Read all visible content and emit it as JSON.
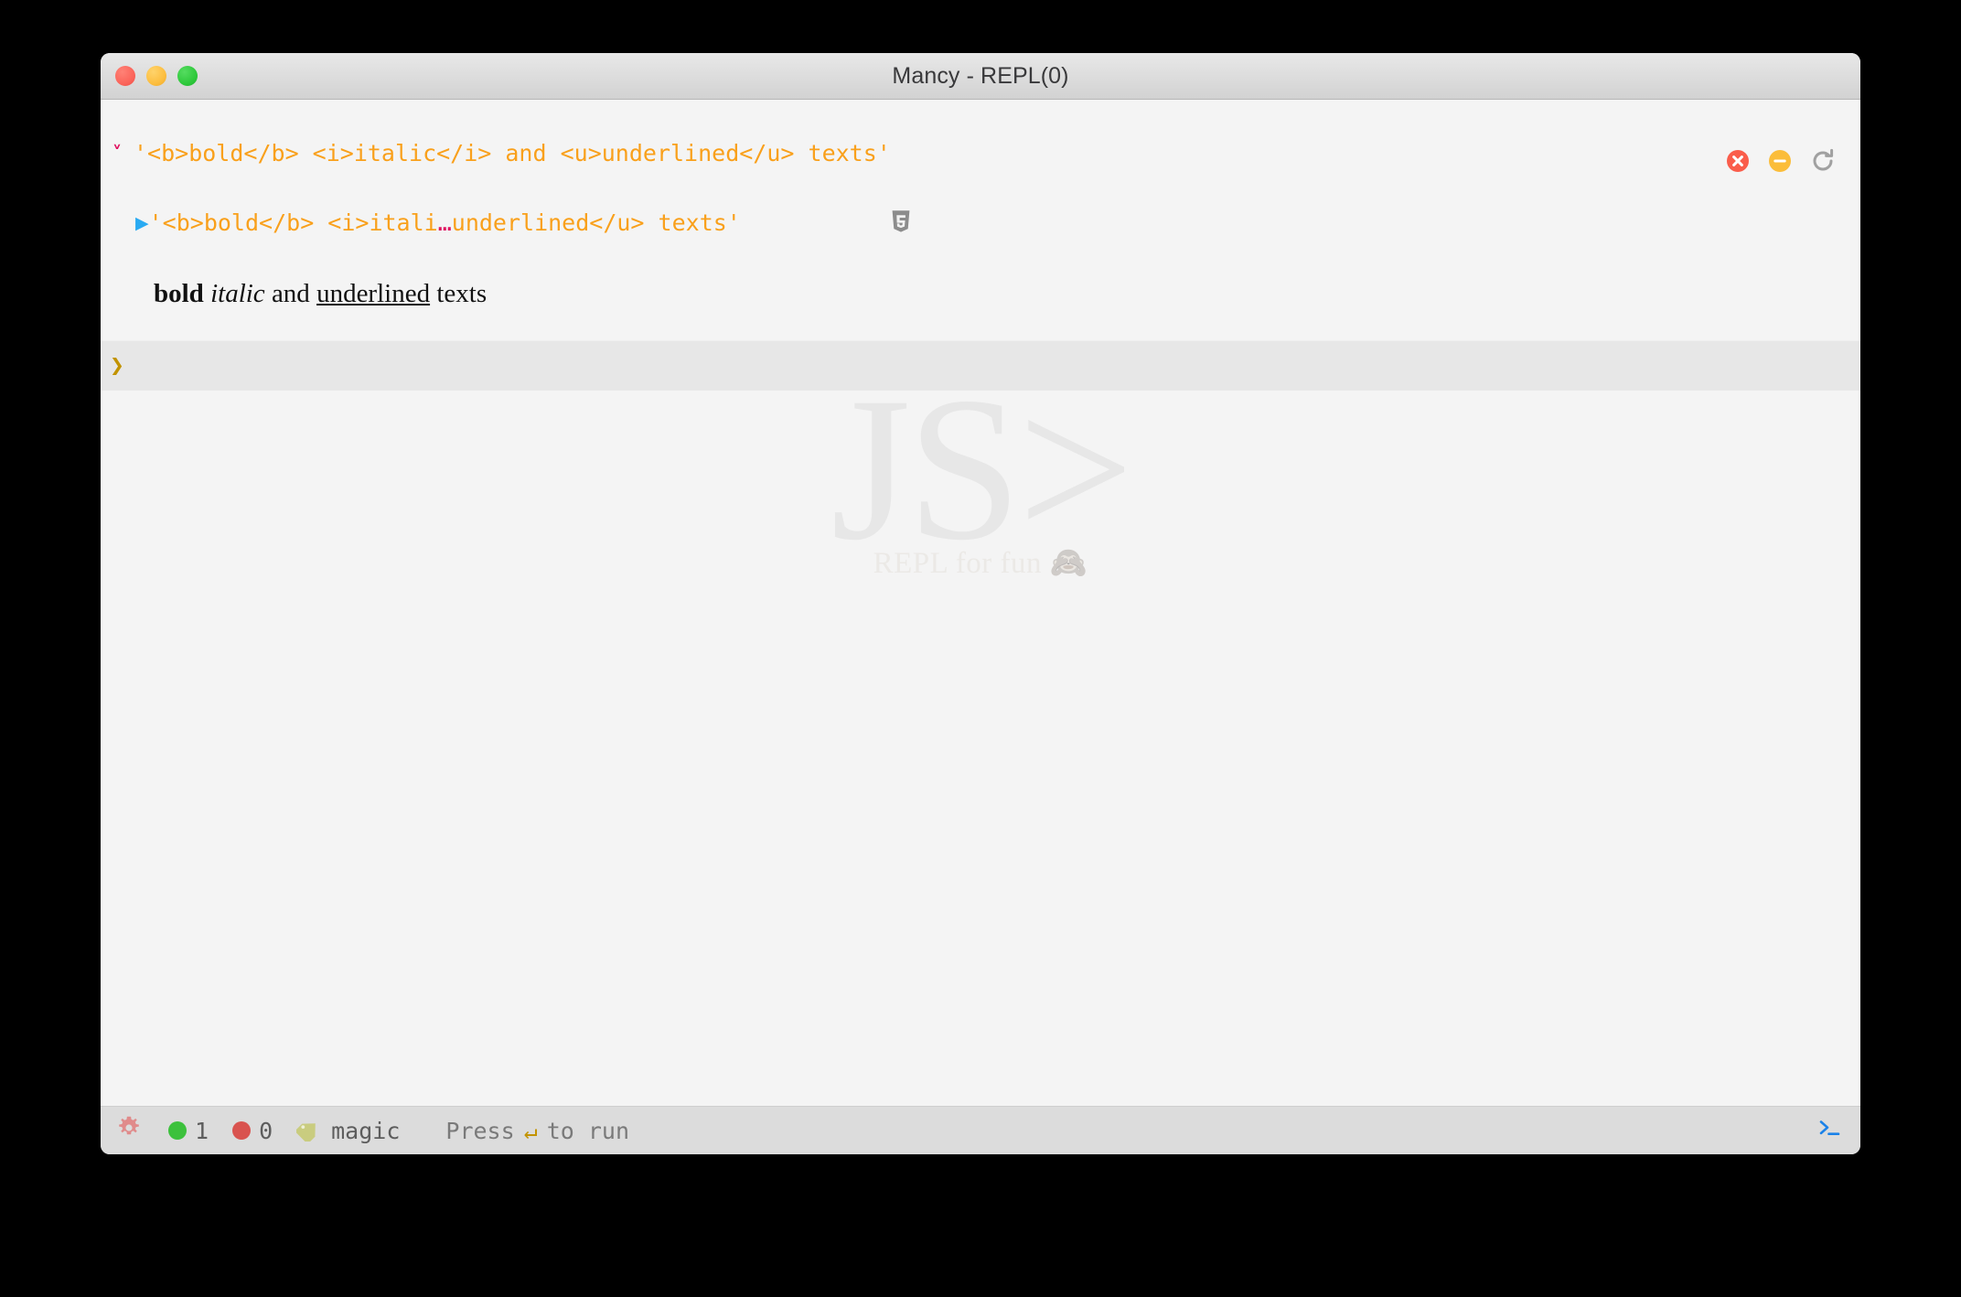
{
  "window": {
    "title": "Mancy - REPL(0)",
    "traffic_lights": [
      {
        "name": "close",
        "color": "#fb655b"
      },
      {
        "name": "minimize",
        "color": "#fcbe40"
      },
      {
        "name": "maximize",
        "color": "#2fc93c"
      }
    ]
  },
  "console": {
    "entry": {
      "fold_icon": "chevron-down",
      "input_code": "'<b>bold</b> <i>italic</i> and <u>underlined</u> texts'",
      "result_caret": "▶",
      "result_prefix": "'<b>bold</b> <i>itali",
      "result_ellipsis": "…",
      "result_suffix": "underlined</u> texts'",
      "result_badge": "html5-badge",
      "rendered": {
        "bold": "bold",
        "italic": "italic",
        "plain_mid": " and ",
        "underlined": "underlined",
        "plain_end": " texts"
      }
    },
    "actions": [
      {
        "name": "clear-entry",
        "icon": "circle-x",
        "color": "#fa5d4b"
      },
      {
        "name": "collapse-entry",
        "icon": "circle-minus",
        "color": "#fbbd3a"
      },
      {
        "name": "rerun-entry",
        "icon": "refresh",
        "color": "#a0a0a0"
      }
    ],
    "prompt": {
      "chevron": "❯",
      "value": "",
      "placeholder": ""
    },
    "watermark": {
      "logo": "JS>",
      "tagline": "REPL for fun",
      "tagline_emoji": "🙈"
    }
  },
  "statusbar": {
    "gear_icon": "gear",
    "success_count": "1",
    "error_count": "0",
    "tag_icon": "tag",
    "tag_label": "magic",
    "hint_prefix": "Press",
    "hint_key": "↵",
    "hint_suffix": "to run",
    "terminal_icon": "terminal-prompt"
  },
  "colors": {
    "code_string": "#f9a01b",
    "fold_chevron": "#e0115f",
    "result_caret": "#29aaf2",
    "prompt_chevron": "#c29300",
    "status_ok": "#3cc13c",
    "status_err": "#d9534f",
    "tag": "#c9cc7f",
    "gear": "#e08b8b",
    "terminal": "#1b82e8"
  }
}
